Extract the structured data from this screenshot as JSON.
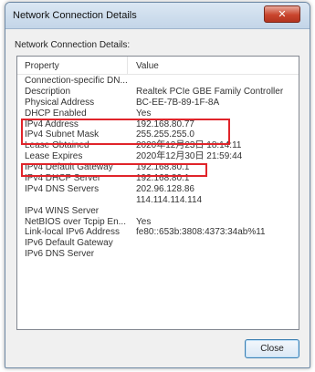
{
  "window": {
    "title": "Network Connection Details",
    "close_glyph": "✕"
  },
  "section_label": "Network Connection Details:",
  "list": {
    "header_property": "Property",
    "header_value": "Value",
    "rows": [
      {
        "property": "Connection-specific DN...",
        "value": ""
      },
      {
        "property": "Description",
        "value": "Realtek PCIe GBE Family Controller"
      },
      {
        "property": "Physical Address",
        "value": "BC-EE-7B-89-1F-8A"
      },
      {
        "property": "DHCP Enabled",
        "value": "Yes"
      },
      {
        "property": "IPv4 Address",
        "value": "192.168.80.77"
      },
      {
        "property": "IPv4 Subnet Mask",
        "value": "255.255.255.0"
      },
      {
        "property": "Lease Obtained",
        "value": "2020年12月23日 18:14:11"
      },
      {
        "property": "Lease Expires",
        "value": "2020年12月30日 21:59:44"
      },
      {
        "property": "IPv4 Default Gateway",
        "value": "192.168.80.1"
      },
      {
        "property": "IPv4 DHCP Server",
        "value": "192.168.80.1"
      },
      {
        "property": "IPv4 DNS Servers",
        "value": "202.96.128.86"
      },
      {
        "property": "",
        "value": "114.114.114.114"
      },
      {
        "property": "IPv4 WINS Server",
        "value": ""
      },
      {
        "property": "NetBIOS over Tcpip En...",
        "value": "Yes"
      },
      {
        "property": "Link-local IPv6 Address",
        "value": "fe80::653b:3808:4373:34ab%11"
      },
      {
        "property": "IPv6 Default Gateway",
        "value": ""
      },
      {
        "property": "IPv6 DNS Server",
        "value": ""
      }
    ]
  },
  "buttons": {
    "close_label": "Close"
  },
  "colors": {
    "highlight": "#e0242a",
    "close_button_red": "#c9452d"
  }
}
